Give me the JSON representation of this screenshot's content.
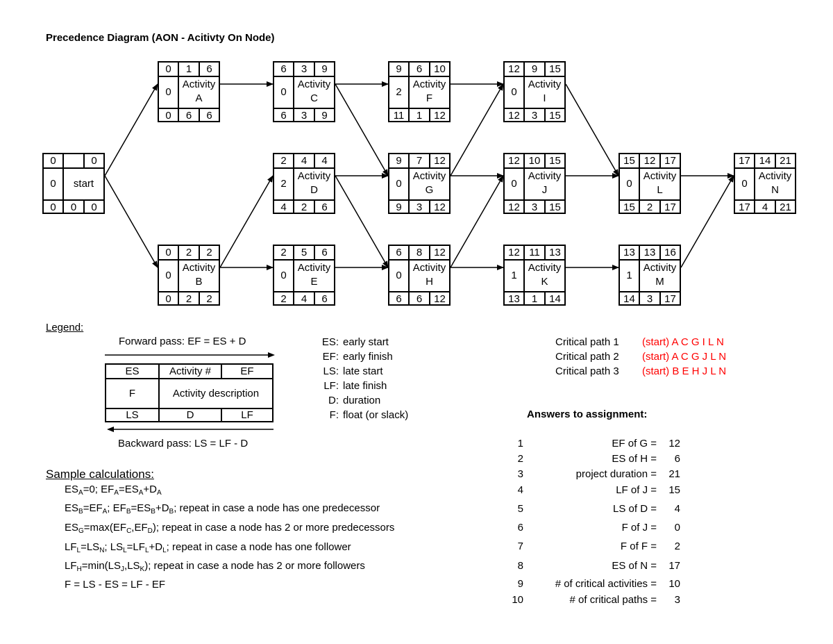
{
  "title": "Precedence Diagram (AON - Acitivty On Node)",
  "activity_word": "Activity",
  "nodes": {
    "start": {
      "es": "0",
      "num": "",
      "ef": "0",
      "f": "0",
      "name": "start",
      "ls": "0",
      "d": "0",
      "lf": "0"
    },
    "A": {
      "es": "0",
      "num": "1",
      "ef": "6",
      "f": "0",
      "name": "A",
      "ls": "0",
      "d": "6",
      "lf": "6"
    },
    "B": {
      "es": "0",
      "num": "2",
      "ef": "2",
      "f": "0",
      "name": "B",
      "ls": "0",
      "d": "2",
      "lf": "2"
    },
    "C": {
      "es": "6",
      "num": "3",
      "ef": "9",
      "f": "0",
      "name": "C",
      "ls": "6",
      "d": "3",
      "lf": "9"
    },
    "D": {
      "es": "2",
      "num": "4",
      "ef": "4",
      "f": "2",
      "name": "D",
      "ls": "4",
      "d": "2",
      "lf": "6"
    },
    "E": {
      "es": "2",
      "num": "5",
      "ef": "6",
      "f": "0",
      "name": "E",
      "ls": "2",
      "d": "4",
      "lf": "6"
    },
    "F": {
      "es": "9",
      "num": "6",
      "ef": "10",
      "f": "2",
      "name": "F",
      "ls": "11",
      "d": "1",
      "lf": "12"
    },
    "G": {
      "es": "9",
      "num": "7",
      "ef": "12",
      "f": "0",
      "name": "G",
      "ls": "9",
      "d": "3",
      "lf": "12"
    },
    "H": {
      "es": "6",
      "num": "8",
      "ef": "12",
      "f": "0",
      "name": "H",
      "ls": "6",
      "d": "6",
      "lf": "12"
    },
    "I": {
      "es": "12",
      "num": "9",
      "ef": "15",
      "f": "0",
      "name": "I",
      "ls": "12",
      "d": "3",
      "lf": "15"
    },
    "J": {
      "es": "12",
      "num": "10",
      "ef": "15",
      "f": "0",
      "name": "J",
      "ls": "12",
      "d": "3",
      "lf": "15"
    },
    "K": {
      "es": "12",
      "num": "11",
      "ef": "13",
      "f": "1",
      "name": "K",
      "ls": "13",
      "d": "1",
      "lf": "14"
    },
    "L": {
      "es": "15",
      "num": "12",
      "ef": "17",
      "f": "0",
      "name": "L",
      "ls": "15",
      "d": "2",
      "lf": "17"
    },
    "M": {
      "es": "13",
      "num": "13",
      "ef": "16",
      "f": "1",
      "name": "M",
      "ls": "14",
      "d": "3",
      "lf": "17"
    },
    "N": {
      "es": "17",
      "num": "14",
      "ef": "21",
      "f": "0",
      "name": "N",
      "ls": "17",
      "d": "4",
      "lf": "21"
    }
  },
  "edges": [
    [
      "start",
      "A"
    ],
    [
      "start",
      "B"
    ],
    [
      "A",
      "C"
    ],
    [
      "B",
      "D"
    ],
    [
      "B",
      "E"
    ],
    [
      "C",
      "F"
    ],
    [
      "C",
      "G"
    ],
    [
      "D",
      "G"
    ],
    [
      "D",
      "H"
    ],
    [
      "E",
      "H"
    ],
    [
      "F",
      "I"
    ],
    [
      "G",
      "I"
    ],
    [
      "G",
      "J"
    ],
    [
      "H",
      "J"
    ],
    [
      "H",
      "K"
    ],
    [
      "I",
      "L"
    ],
    [
      "J",
      "L"
    ],
    [
      "K",
      "M"
    ],
    [
      "L",
      "N"
    ],
    [
      "M",
      "N"
    ]
  ],
  "legend": {
    "label": "Legend:",
    "forward": "Forward pass: EF = ES + D",
    "backward": "Backward pass: LS = LF - D",
    "box": {
      "es": "ES",
      "num": "Activity #",
      "ef": "EF",
      "f": "F",
      "desc": "Activity description",
      "ls": "LS",
      "d": "D",
      "lf": "LF"
    },
    "definitions": [
      {
        "key": "ES:",
        "text": "early start"
      },
      {
        "key": "EF:",
        "text": "early finish"
      },
      {
        "key": "LS:",
        "text": "late start"
      },
      {
        "key": "LF:",
        "text": "late finish"
      },
      {
        "key": "D:",
        "text": "duration"
      },
      {
        "key": "F:",
        "text": "float (or slack)"
      }
    ]
  },
  "critical_paths": [
    {
      "label": "Critical path 1",
      "path": "(start) A C G I L N"
    },
    {
      "label": "Critical path 2",
      "path": "(start) A C G J L N"
    },
    {
      "label": "Critical path 3",
      "path": "(start) B E H J L N"
    }
  ],
  "critical_color": "#ff0000",
  "answers": {
    "title": "Answers to assignment:",
    "items": [
      {
        "n": "1",
        "q": "EF of G =",
        "v": "12"
      },
      {
        "n": "2",
        "q": "ES of H =",
        "v": "6"
      },
      {
        "n": "3",
        "q": "project duration =",
        "v": "21"
      },
      {
        "n": "4",
        "q": "LF of J =",
        "v": "15"
      },
      {
        "n": "5",
        "q": "LS of D =",
        "v": "4"
      },
      {
        "n": "6",
        "q": "F of J =",
        "v": "0"
      },
      {
        "n": "7",
        "q": "F of F =",
        "v": "2"
      },
      {
        "n": "8",
        "q": "ES of N =",
        "v": "17"
      },
      {
        "n": "9",
        "q": "# of critical activities =",
        "v": "10"
      },
      {
        "n": "10",
        "q": "# of critical paths =",
        "v": "3"
      }
    ]
  },
  "sample": {
    "title": "Sample calculations:",
    "lines": [
      [
        [
          "ES",
          ""
        ],
        [
          "A",
          "s"
        ],
        [
          "=0; EF",
          ""
        ],
        [
          "A",
          "s"
        ],
        [
          "=ES",
          ""
        ],
        [
          "A",
          "s"
        ],
        [
          "+D",
          ""
        ],
        [
          "A",
          "s"
        ]
      ],
      [
        [
          "ES",
          ""
        ],
        [
          "B",
          "s"
        ],
        [
          "=EF",
          ""
        ],
        [
          "A",
          "s"
        ],
        [
          "; EF",
          ""
        ],
        [
          "B",
          "s"
        ],
        [
          "=ES",
          ""
        ],
        [
          "B",
          "s"
        ],
        [
          "+D",
          ""
        ],
        [
          "B",
          "s"
        ],
        [
          "; repeat in case a node has one predecessor",
          ""
        ]
      ],
      [
        [
          "ES",
          ""
        ],
        [
          "G",
          "s"
        ],
        [
          "=max(EF",
          ""
        ],
        [
          "C",
          "s"
        ],
        [
          ",EF",
          ""
        ],
        [
          "D",
          "s"
        ],
        [
          "); repeat in case a node has 2 or more predecessors",
          ""
        ]
      ],
      [
        [
          "LF",
          ""
        ],
        [
          "L",
          "s"
        ],
        [
          "=LS",
          ""
        ],
        [
          "N",
          "s"
        ],
        [
          "; LS",
          ""
        ],
        [
          "L",
          "s"
        ],
        [
          "=LF",
          ""
        ],
        [
          "L",
          "s"
        ],
        [
          "+D",
          ""
        ],
        [
          "L",
          "s"
        ],
        [
          "; repeat in case a node has one follower",
          ""
        ]
      ],
      [
        [
          "LF",
          ""
        ],
        [
          "H",
          "s"
        ],
        [
          "=min(LS",
          ""
        ],
        [
          "J",
          "s"
        ],
        [
          ",LS",
          ""
        ],
        [
          "K",
          "s"
        ],
        [
          "); repeat in case a node has 2 or more followers",
          ""
        ]
      ],
      [
        [
          "F = LS - ES = LF - EF",
          ""
        ]
      ]
    ]
  }
}
